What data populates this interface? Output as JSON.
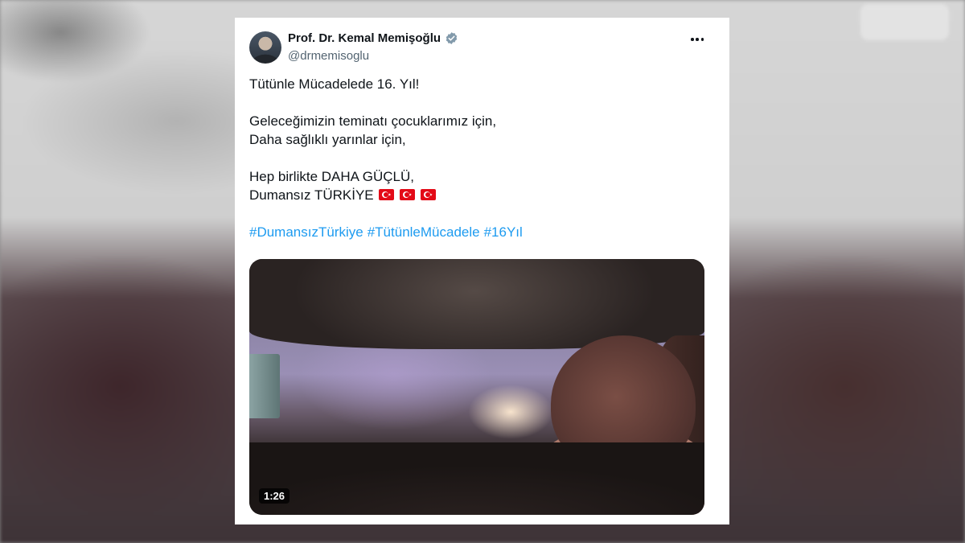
{
  "author": {
    "name": "Prof. Dr. Kemal Memişoğlu",
    "handle": "@drmemisoglu",
    "verified": true
  },
  "tweet": {
    "line1": "Tütünle Mücadelede 16. Yıl!",
    "line2": "Geleceğimizin teminatı çocuklarımız için,",
    "line3": "Daha sağlıklı yarınlar için,",
    "line4": "Hep birlikte DAHA GÜÇLÜ,",
    "line5": "Dumansız TÜRKİYE",
    "flags": [
      "turkey-flag",
      "turkey-flag",
      "turkey-flag"
    ],
    "hashtags": [
      "#DumansızTürkiye",
      "#TütünleMücadele",
      "#16Yıl"
    ]
  },
  "media": {
    "type": "video",
    "duration": "1:26"
  },
  "icons": {
    "verified": "verified-badge-icon",
    "more": "more-options-icon"
  },
  "colors": {
    "link": "#1d9bf0",
    "text": "#0f1419",
    "secondary": "#536471",
    "verified": "#829aab"
  }
}
